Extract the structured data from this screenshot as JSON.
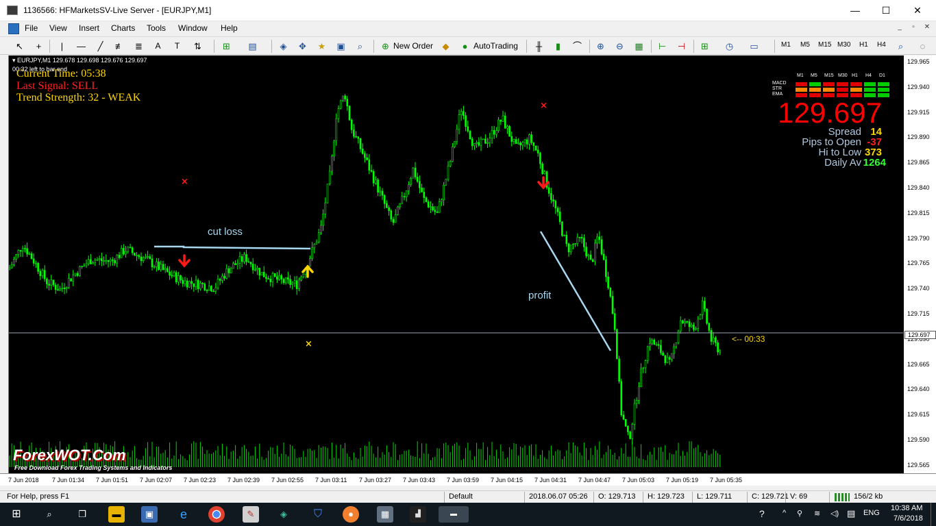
{
  "window": {
    "title": "1136566: HFMarketsSV-Live Server - [EURJPY,M1]",
    "minimize": "—",
    "maximize": "☐",
    "close": "✕"
  },
  "menu": {
    "items": [
      "File",
      "View",
      "Insert",
      "Charts",
      "Tools",
      "Window",
      "Help"
    ],
    "mdi": [
      "_",
      "▫",
      "✕"
    ]
  },
  "toolbar": {
    "new_order": "New Order",
    "auto_trading": "AutoTrading",
    "timeframes": [
      "M1",
      "M5",
      "M15",
      "M30",
      "H1",
      "H4"
    ]
  },
  "chart": {
    "header": "EURJPY,M1  129.678 129.698 129.676 129.697",
    "bar_timer": "00:32 left to bar end",
    "current_time": "Current Time: 05:38",
    "last_signal": "Last Signal: SELL",
    "trend_strength": "Trend Strength: 32 - WEAK",
    "cut_loss_label": "cut loss",
    "profit_label": "profit",
    "countdown": "<-- 00:33",
    "watermark_title": "ForexWOT.Com",
    "watermark_sub": "Free Download Forex Trading Systems and Indicators",
    "colors": {
      "candle": "#00ff00",
      "sell_arrow": "#ff1a1a",
      "buy_arrow": "#ffd700",
      "annotation_line": "#a8d8f0",
      "price_big": "#ff0000",
      "label_yellow": "#ffd700",
      "label_red": "#ff2020",
      "info_label": "#b0c8e0"
    },
    "panel": {
      "timeframes": [
        "M1",
        "M5",
        "M15",
        "M30",
        "H1",
        "H4",
        "D1"
      ],
      "rows": [
        {
          "name": "MACD",
          "cells": [
            "red",
            "green",
            "red",
            "red",
            "red",
            "green",
            "green"
          ]
        },
        {
          "name": "STR",
          "cells": [
            "orange",
            "orange",
            "orange",
            "red",
            "orange",
            "green",
            "green"
          ]
        },
        {
          "name": "EMA",
          "cells": [
            "red",
            "red",
            "red",
            "red",
            "red",
            "green",
            "green"
          ]
        }
      ],
      "price": "129.697",
      "spread_label": "Spread",
      "spread_value": "14",
      "pips_label": "Pips to Open",
      "pips_value": "-37",
      "hilo_label": "Hi to Low",
      "hilo_value": "373",
      "daily_label": "Daily Av",
      "daily_value": "1264"
    },
    "price_levels": [
      "129.965",
      "129.940",
      "129.915",
      "129.890",
      "129.865",
      "129.840",
      "129.815",
      "129.790",
      "129.765",
      "129.740",
      "129.715",
      "129.690",
      "129.665",
      "129.640",
      "129.615",
      "129.590",
      "129.565"
    ],
    "current_price_tag": "129.697",
    "time_labels": [
      "7 Jun 2018",
      "7 Jun 01:34",
      "7 Jun 01:51",
      "7 Jun 02:07",
      "7 Jun 02:23",
      "7 Jun 02:39",
      "7 Jun 02:55",
      "7 Jun 03:11",
      "7 Jun 03:27",
      "7 Jun 03:43",
      "7 Jun 03:59",
      "7 Jun 04:15",
      "7 Jun 04:31",
      "7 Jun 04:47",
      "7 Jun 05:03",
      "7 Jun 05:19",
      "7 Jun 05:35"
    ]
  },
  "status": {
    "help": "For Help, press F1",
    "profile": "Default",
    "datetime": "2018.06.07 05:26",
    "open": "O: 129.713",
    "high": "H: 129.723",
    "low": "L: 129.711",
    "close": "C: 129.721",
    "volume": "V: 69",
    "traffic": "156/2 kb"
  },
  "taskbar": {
    "lang": "ENG",
    "time": "10:38 AM",
    "date": "7/6/2018",
    "apps": [
      "windows-logo",
      "search",
      "task-view",
      "file-explorer",
      "app-5",
      "edge",
      "chrome",
      "paint",
      "app-9",
      "shield",
      "app-11",
      "app-12",
      "mt4",
      "mt4-active"
    ]
  }
}
